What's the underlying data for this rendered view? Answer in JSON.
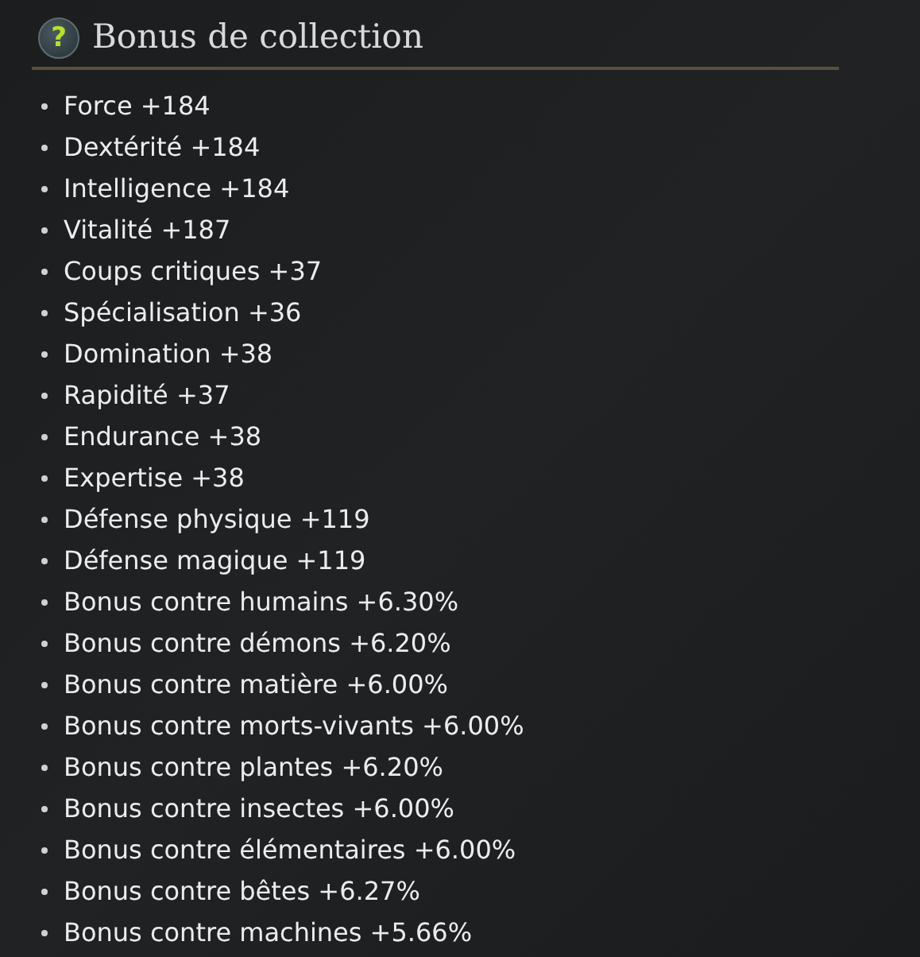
{
  "header": {
    "help_icon": "?",
    "title": "Bonus de collection"
  },
  "stats": [
    {
      "label": "Force +184"
    },
    {
      "label": "Dextérité +184"
    },
    {
      "label": "Intelligence +184"
    },
    {
      "label": "Vitalité +187"
    },
    {
      "label": "Coups critiques +37"
    },
    {
      "label": "Spécialisation +36"
    },
    {
      "label": "Domination +38"
    },
    {
      "label": "Rapidité +37"
    },
    {
      "label": "Endurance +38"
    },
    {
      "label": "Expertise +38"
    },
    {
      "label": "Défense physique +119"
    },
    {
      "label": "Défense magique +119"
    },
    {
      "label": "Bonus contre humains +6.30%"
    },
    {
      "label": "Bonus contre démons +6.20%"
    },
    {
      "label": "Bonus contre matière +6.00%"
    },
    {
      "label": "Bonus contre morts-vivants +6.00%"
    },
    {
      "label": "Bonus contre plantes +6.20%"
    },
    {
      "label": "Bonus contre insectes +6.00%"
    },
    {
      "label": "Bonus contre élémentaires +6.00%"
    },
    {
      "label": "Bonus contre bêtes +6.27%"
    },
    {
      "label": "Bonus contre machines +5.66%"
    }
  ]
}
